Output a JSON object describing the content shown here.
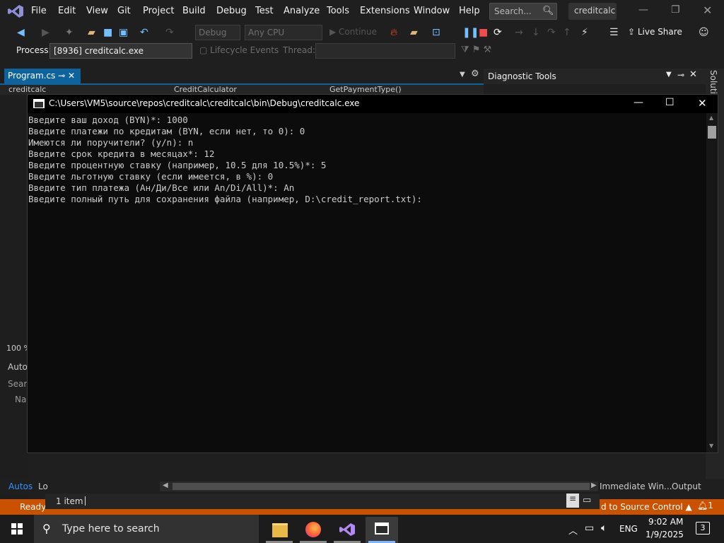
{
  "menu": {
    "items": [
      "File",
      "Edit",
      "View",
      "Git",
      "Project",
      "Build",
      "Debug",
      "Test",
      "Analyze",
      "Tools",
      "Extensions",
      "Window",
      "Help"
    ],
    "search_placeholder": "Search...",
    "solution_name": "creditcalc"
  },
  "toolbar": {
    "config": "Debug",
    "platform": "Any CPU",
    "continue_label": "Continue",
    "live_share": "Live Share"
  },
  "process_bar": {
    "label": "Process:",
    "process": "[8936] creditcalc.exe",
    "lifecycle": "Lifecycle Events",
    "thread": "Thread:"
  },
  "editor": {
    "tab": "Program.cs",
    "nav_project": "creditcalc",
    "nav_class": "CreditCalculator",
    "nav_member": "GetPaymentType()"
  },
  "diagnostic": {
    "title": "Diagnostic Tools"
  },
  "solution_panel": {
    "label": "Solutio"
  },
  "left_panel": {
    "zoom": "100 %",
    "autos": "Autos",
    "search": "Search",
    "name": "Name"
  },
  "console": {
    "title": "C:\\Users\\VM5\\source\\repos\\creditcalc\\creditcalc\\bin\\Debug\\creditcalc.exe",
    "lines": [
      "Введите ваш доход (BYN)*: 1000",
      "Введите платежи по кредитам (BYN, если нет, то 0): 0",
      "Имеются ли поручители? (y/n): n",
      "Введите срок кредита в месяцах*: 12",
      "Введите процентную ставку (например, 10.5 для 10.5%)*: 5",
      "Введите льготную ставку (если имеется, в %): 0",
      "Введите тип платежа (Ан/Ди/Все или An/Di/All)*: An",
      "Введите полный путь для сохранения файла (например, D:\\credit_report.txt):"
    ]
  },
  "bottom": {
    "autos": "Autos",
    "locals": "Lo",
    "immediate": "Immediate Win...",
    "output": "Output",
    "items": "1 item"
  },
  "status": {
    "ready": "Ready",
    "source_control": "d to Source Control",
    "notif": "1"
  },
  "taskbar": {
    "search": "Type here to search",
    "lang": "ENG",
    "time": "9:02 AM",
    "date": "1/9/2025",
    "notif_count": "3"
  }
}
